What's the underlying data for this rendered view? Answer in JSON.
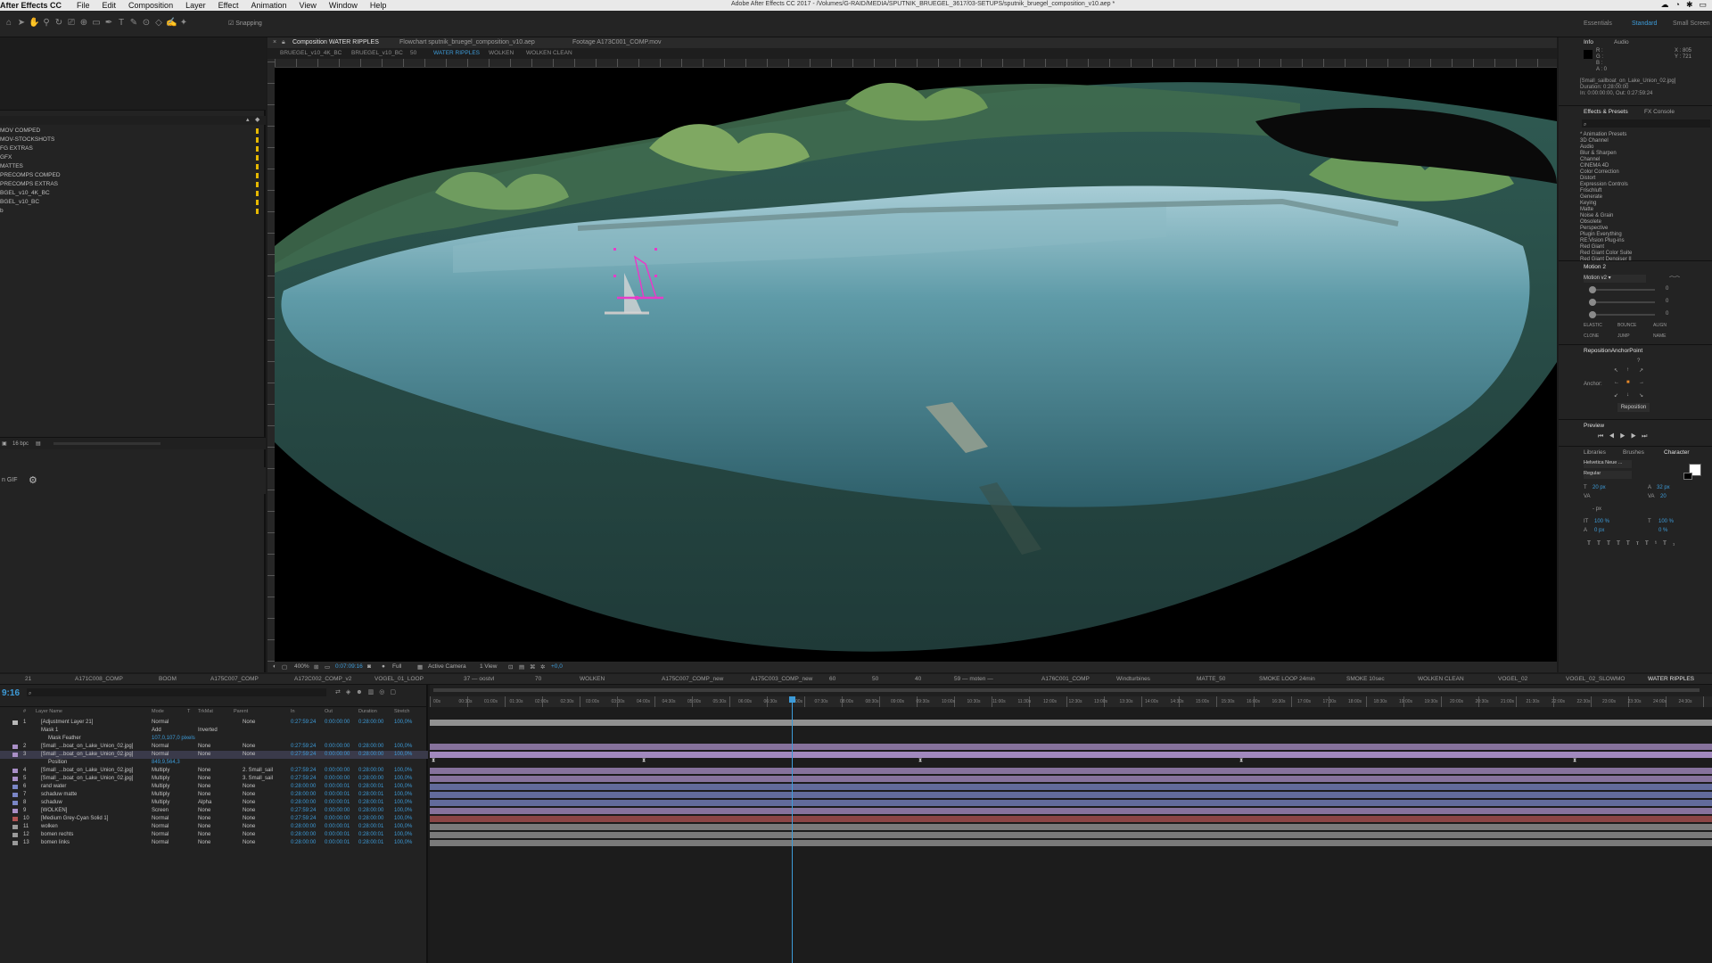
{
  "menubar": {
    "app_name": "After Effects CC",
    "items": [
      "File",
      "Edit",
      "Composition",
      "Layer",
      "Effect",
      "Animation",
      "View",
      "Window",
      "Help"
    ],
    "window_title": "Adobe After Effects CC 2017 - /Volumes/G-RAID/MEDIA/SPUTNIK_BRUEGEL_3617/03-SETUPS/sputnik_bruegel_composition_v10.aep *"
  },
  "toolbar": {
    "snapping_label": "Snapping",
    "workspaces": [
      "Essentials",
      "Standard",
      "Small Screen"
    ],
    "active_workspace": "Standard"
  },
  "project": {
    "folders": [
      "MOV COMPED",
      "MOV-STOCKSHOTS",
      "FG EXTRAS",
      "GFX",
      "MATTES",
      "PRECOMPS COMPED",
      "PRECOMPS EXTRAS",
      "BGEL_v10_4K_BC",
      "BGEL_v10_BC",
      "b"
    ],
    "bpc_label": "16 bpc",
    "gif_label": "n GIF"
  },
  "viewer": {
    "tabs": [
      "Composition WATER RIPPLES",
      "Flowchart sputnik_bruegel_composition_v10.aep",
      "Footage A173C001_COMP.mov"
    ],
    "breadcrumbs": [
      "BRUEGEL_v10_4K_BC",
      "BRUEGEL_v10_BC",
      "50",
      "WATER RIPPLES",
      "WOLKEN",
      "WOLKEN CLEAN"
    ],
    "active_crumb": "WATER RIPPLES",
    "footer": {
      "zoom": "400%",
      "timecode": "0:07:09:16",
      "resolution": "Full",
      "camera": "Active Camera",
      "views": "1 View",
      "exposure": "+0,0"
    }
  },
  "right_panel": {
    "info_tabs": [
      "Info",
      "Audio"
    ],
    "info": {
      "r": "R :",
      "g": "G :",
      "b": "B :",
      "a": "A : 0",
      "x": "X : 805",
      "y": "Y : 721",
      "file": "[Small_sailboat_on_Lake_Union_02.jpg]",
      "duration": "Duration: 0:28:00:00",
      "inout": "In: 0:00:00:00, Out: 0:27:59:24"
    },
    "effects_tabs": [
      "Effects & Presets",
      "FX Console"
    ],
    "effects": [
      "* Animation Presets",
      "3D Channel",
      "Audio",
      "Blur & Sharpen",
      "Channel",
      "CINEMA 4D",
      "Color Correction",
      "Distort",
      "Expression Controls",
      "Frischluft",
      "Generate",
      "Keying",
      "Matte",
      "Noise & Grain",
      "Obsolete",
      "Perspective",
      "Plugin Everything",
      "RE:Vision Plug-ins",
      "Red Giant",
      "Red Giant Color Suite",
      "Red Giant Denoiser II"
    ],
    "motion": {
      "title": "Motion 2",
      "preset": "Motion v2",
      "values": [
        "0",
        "0",
        "0"
      ],
      "buttons": [
        "ELASTIC",
        "BOUNCE",
        "ALIGN",
        "CLONE",
        "JUMP",
        "NAME"
      ]
    },
    "anchor": {
      "title": "RepositionAnchorPoint",
      "label": "Anchor:",
      "help": "?",
      "button": "Reposition"
    },
    "preview_title": "Preview",
    "char_tabs": [
      "Libraries",
      "Brushes",
      "Character"
    ],
    "character": {
      "font": "Helvetica Neue ...",
      "style": "Regular",
      "size": "20 px",
      "leading": "32 px",
      "tracking": "20",
      "kerning_label": "VA",
      "stroke": "- px",
      "vscale": "100 %",
      "hscale": "100 %",
      "baseline": "0 px",
      "tsume": "0 %"
    }
  },
  "timeline": {
    "tabs": [
      "21",
      "A171C008_COMP",
      "BOOM",
      "A175C007_COMP",
      "A172C002_COMP_v2",
      "VOGEL_01_LOOP",
      "37 — oostvl",
      "70",
      "WOLKEN",
      "A175C007_COMP_new",
      "A175C003_COMP_new",
      "60",
      "50",
      "40",
      "59 — moten —",
      "A176C001_COMP",
      "Windturbines",
      "MATTE_50",
      "SMOKE LOOP 24min",
      "SMOKE 10sec",
      "WOLKEN CLEAN",
      "VOGEL_02",
      "VOGEL_02_SLOWMO",
      "WATER RIPPLES"
    ],
    "active_tab": "WATER RIPPLES",
    "timecode": "9:16",
    "columns": [
      "#",
      "Layer Name",
      "Mode",
      "T",
      "TrkMat",
      "Parent",
      "In",
      "Out",
      "Duration",
      "Stretch"
    ],
    "ruler_ticks": [
      "00s",
      "00:30s",
      "01:00s",
      "01:30s",
      "02:00s",
      "02:30s",
      "03:00s",
      "03:30s",
      "04:00s",
      "04:30s",
      "05:00s",
      "05:30s",
      "06:00s",
      "06:30s",
      "07:00s",
      "07:30s",
      "08:00s",
      "08:30s",
      "09:00s",
      "09:30s",
      "10:00s",
      "10:30s",
      "11:00s",
      "11:30s",
      "12:00s",
      "12:30s",
      "13:00s",
      "13:30s",
      "14:00s",
      "14:30s",
      "15:00s",
      "15:30s",
      "16:00s",
      "16:30s",
      "17:00s",
      "17:30s",
      "18:00s",
      "18:30s",
      "19:00s",
      "19:30s",
      "20:00s",
      "20:30s",
      "21:00s",
      "21:30s",
      "22:00s",
      "22:30s",
      "23:00s",
      "23:30s",
      "24:00s",
      "24:30s"
    ],
    "sub_rows": {
      "mask": "Mask 1",
      "mask_mode": "Add",
      "mask_inverted": "Inverted",
      "mask_feather": "Mask Feather",
      "mask_feather_value": "107,0,107,0 pixels",
      "position": "Position",
      "position_value": "849,9,564,3"
    },
    "layers": [
      {
        "num": "1",
        "name": "[Adjustment Layer 21]",
        "mode": "Normal",
        "trk": "",
        "parent": "None",
        "in": "0:27:59:24",
        "out": "0:00:00:00",
        "dur": "0:28:00:00",
        "str": "100,0%",
        "color": "#b8b8b8"
      },
      {
        "num": "2",
        "name": "[Small_...boat_on_Lake_Union_02.jpg]",
        "mode": "Normal",
        "trk": "None",
        "parent": "None",
        "in": "0:27:59:24",
        "out": "0:00:00:00",
        "dur": "0:28:00:00",
        "str": "100,0%",
        "color": "#a98fc7"
      },
      {
        "num": "3",
        "name": "[Small_...boat_on_Lake_Union_02.jpg]",
        "mode": "Normal",
        "trk": "None",
        "parent": "None",
        "in": "0:27:59:24",
        "out": "0:00:00:00",
        "dur": "0:28:00:00",
        "str": "100,0%",
        "color": "#a98fc7"
      },
      {
        "num": "4",
        "name": "[Small_...boat_on_Lake_Union_02.jpg]",
        "mode": "Multiply",
        "trk": "None",
        "parent": "2. Small_sail",
        "in": "0:27:59:24",
        "out": "0:00:00:00",
        "dur": "0:28:00:00",
        "str": "100,0%",
        "color": "#a98fc7"
      },
      {
        "num": "5",
        "name": "[Small_...boat_on_Lake_Union_02.jpg]",
        "mode": "Multiply",
        "trk": "None",
        "parent": "3. Small_sail",
        "in": "0:27:59:24",
        "out": "0:00:00:00",
        "dur": "0:28:00:00",
        "str": "100,0%",
        "color": "#a98fc7"
      },
      {
        "num": "6",
        "name": "rand water",
        "mode": "Multiply",
        "trk": "None",
        "parent": "None",
        "in": "0:28:00:00",
        "out": "0:00:00:01",
        "dur": "0:28:00:01",
        "str": "100,0%",
        "color": "#7a86c6"
      },
      {
        "num": "7",
        "name": "schaduw matte",
        "mode": "Multiply",
        "trk": "None",
        "parent": "None",
        "in": "0:28:00:00",
        "out": "0:00:00:01",
        "dur": "0:28:00:01",
        "str": "100,0%",
        "color": "#7a86c6"
      },
      {
        "num": "8",
        "name": "schaduw",
        "mode": "Multiply",
        "trk": "Alpha",
        "parent": "None",
        "in": "0:28:00:00",
        "out": "0:00:00:01",
        "dur": "0:28:00:01",
        "str": "100,0%",
        "color": "#7a86c6"
      },
      {
        "num": "9",
        "name": "[WOLKEN]",
        "mode": "Screen",
        "trk": "None",
        "parent": "None",
        "in": "0:27:59:24",
        "out": "0:00:00:00",
        "dur": "0:28:00:00",
        "str": "100,0%",
        "color": "#a98fc7"
      },
      {
        "num": "10",
        "name": "[Medium Grey-Cyan Solid 1]",
        "mode": "Normal",
        "trk": "None",
        "parent": "None",
        "in": "0:27:59:24",
        "out": "0:00:00:00",
        "dur": "0:28:00:00",
        "str": "100,0%",
        "color": "#b05353"
      },
      {
        "num": "11",
        "name": "wolken",
        "mode": "Normal",
        "trk": "None",
        "parent": "None",
        "in": "0:28:00:00",
        "out": "0:00:00:01",
        "dur": "0:28:00:01",
        "str": "100,0%",
        "color": "#9a9a9a"
      },
      {
        "num": "12",
        "name": "bomen rechts",
        "mode": "Normal",
        "trk": "None",
        "parent": "None",
        "in": "0:28:00:00",
        "out": "0:00:00:01",
        "dur": "0:28:00:01",
        "str": "100,0%",
        "color": "#9a9a9a"
      },
      {
        "num": "13",
        "name": "bomen links",
        "mode": "Normal",
        "trk": "None",
        "parent": "None",
        "in": "0:28:00:00",
        "out": "0:00:00:01",
        "dur": "0:28:00:01",
        "str": "100,0%",
        "color": "#9a9a9a"
      }
    ]
  }
}
